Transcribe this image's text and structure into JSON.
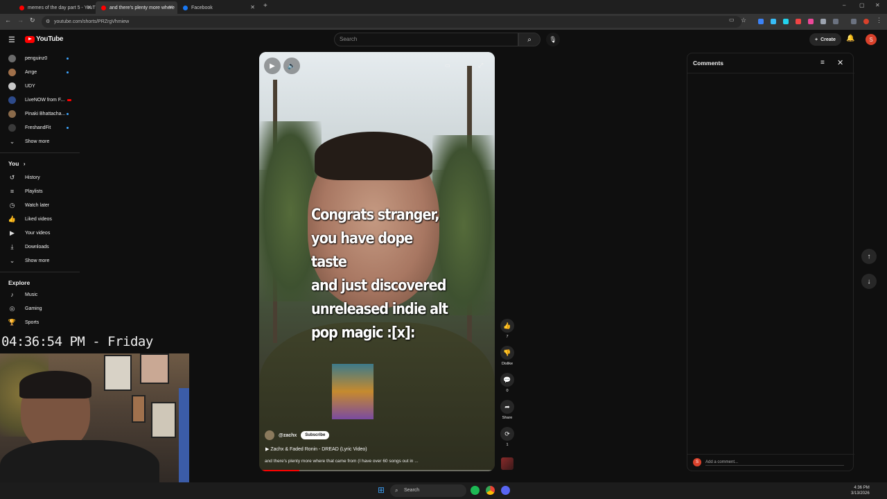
{
  "browser": {
    "tabs": [
      {
        "title": "memes of the day part 5 - YouT",
        "active": false
      },
      {
        "title": "and there's plenty more where",
        "active": true
      },
      {
        "title": "Facebook",
        "active": false
      }
    ],
    "url": "youtube.com/shorts/PRZrgVhmiew"
  },
  "header": {
    "logo_text": "YouTube",
    "search_placeholder": "Search",
    "create_label": "Create",
    "avatar_letter": "S"
  },
  "sidebar": {
    "subscriptions": [
      {
        "label": "penguinz0",
        "color": "#6b6b6b",
        "new": true
      },
      {
        "label": "Arrge",
        "color": "#a0704a",
        "new": true
      },
      {
        "label": "UDY",
        "color": "#c8c8c8",
        "new": false
      },
      {
        "label": "LiveNOW from F...",
        "color": "#2d4a8a",
        "new": true
      },
      {
        "label": "Pinaki Bhattacha...",
        "color": "#8a6a4a",
        "new": true
      },
      {
        "label": "FreshandFit",
        "color": "#3a3a3a",
        "new": true
      }
    ],
    "show_more_1": "Show more",
    "you_label": "You",
    "you_items": [
      "History",
      "Playlists",
      "Watch later",
      "Liked videos",
      "Your videos",
      "Downloads"
    ],
    "show_more_2": "Show more",
    "explore_label": "Explore",
    "explore_items": [
      "Music",
      "Gaming",
      "Sports"
    ]
  },
  "overlay": {
    "clock": "04:36:54 PM - Friday"
  },
  "short": {
    "caption": "Congrats stranger,\nyou have dope taste\nand just discovered\nunreleased indie alt\npop magic :[x]:",
    "channel": "@zachx",
    "subscribe_label": "Subscribe",
    "song": "Zachx & Faded Ronin - DREAD (Lyric Video)",
    "description": "and there's plenty more where that came from (I have over 60 songs out in ...",
    "progress": 0.17
  },
  "actions": {
    "likes": "7",
    "dislike_label": "Dislike",
    "comments": "0",
    "share_label": "Share",
    "remix": "1"
  },
  "comments_panel": {
    "title": "Comments",
    "add_placeholder": "Add a comment...",
    "avatar_letter": "S"
  },
  "taskbar": {
    "search_label": "Search",
    "time": "4:36 PM",
    "date": "3/13/2026"
  }
}
